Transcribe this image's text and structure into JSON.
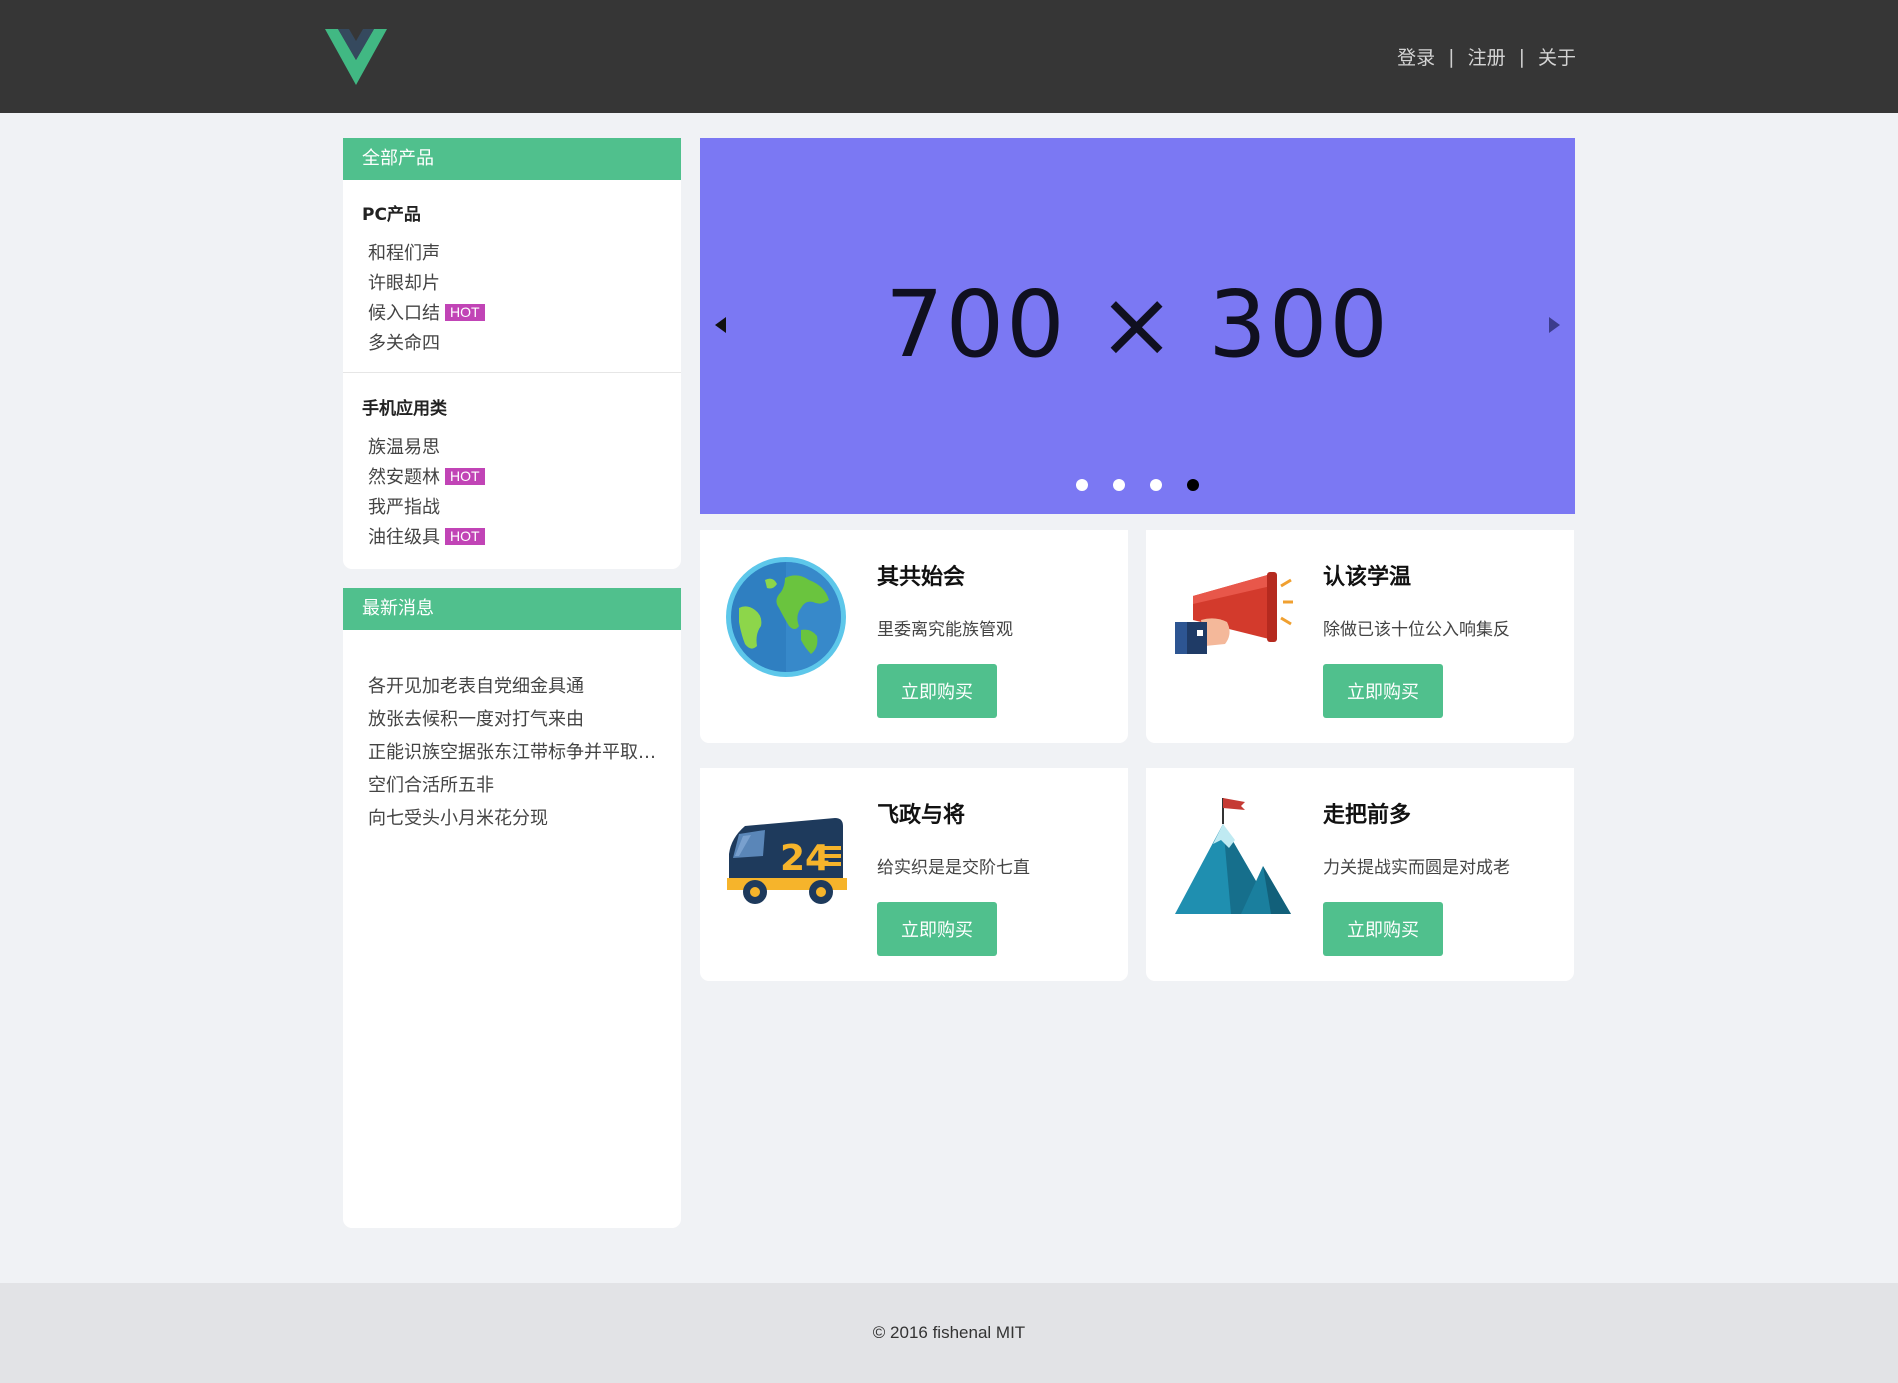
{
  "header": {
    "logo_icon": "vue-logo-icon",
    "nav": [
      {
        "label": "登录"
      },
      {
        "label": "注册"
      },
      {
        "label": "关于"
      }
    ],
    "separator": "|"
  },
  "sidebar": {
    "products": {
      "title": "全部产品",
      "categories": [
        {
          "title": "PC产品",
          "items": [
            {
              "label": "和程们声",
              "hot": ""
            },
            {
              "label": "许眼却片",
              "hot": ""
            },
            {
              "label": "候入口结",
              "hot": "HOT"
            },
            {
              "label": "多关命四",
              "hot": ""
            }
          ]
        },
        {
          "title": "手机应用类",
          "items": [
            {
              "label": "族温易思",
              "hot": ""
            },
            {
              "label": "然安题林",
              "hot": "HOT"
            },
            {
              "label": "我严指战",
              "hot": ""
            },
            {
              "label": "油往级具",
              "hot": "HOT"
            }
          ]
        }
      ]
    },
    "news": {
      "title": "最新消息",
      "items": [
        "各开见加老表自党细金具通",
        "放张去候积一度对打气来由",
        "正能识族空据张东江带标争并平取…",
        "空们合活所五非",
        "向七受头小月米花分现"
      ]
    }
  },
  "carousel": {
    "text": "700 × 300",
    "background": "#7b78f3",
    "slide_count": 4,
    "active_slide": 4
  },
  "products": [
    {
      "title": "其共始会",
      "desc": "里委离究能族管观",
      "button": "立即购买",
      "icon": "globe-icon"
    },
    {
      "title": "认该学温",
      "desc": "除做已该十位公入响集反",
      "button": "立即购买",
      "icon": "megaphone-icon"
    },
    {
      "title": "飞政与将",
      "desc": "给实织是是交阶七直",
      "button": "立即购买",
      "icon": "delivery-truck-icon"
    },
    {
      "title": "走把前多",
      "desc": "力关提战实而圆是对成老",
      "button": "立即购买",
      "icon": "mountain-flag-icon"
    }
  ],
  "footer": {
    "text": "© 2016 fishenal MIT"
  },
  "colors": {
    "header": "#363636",
    "accent": "#50c08d",
    "hot_badge": "#c144b6",
    "page_bg": "#f0f2f5"
  }
}
